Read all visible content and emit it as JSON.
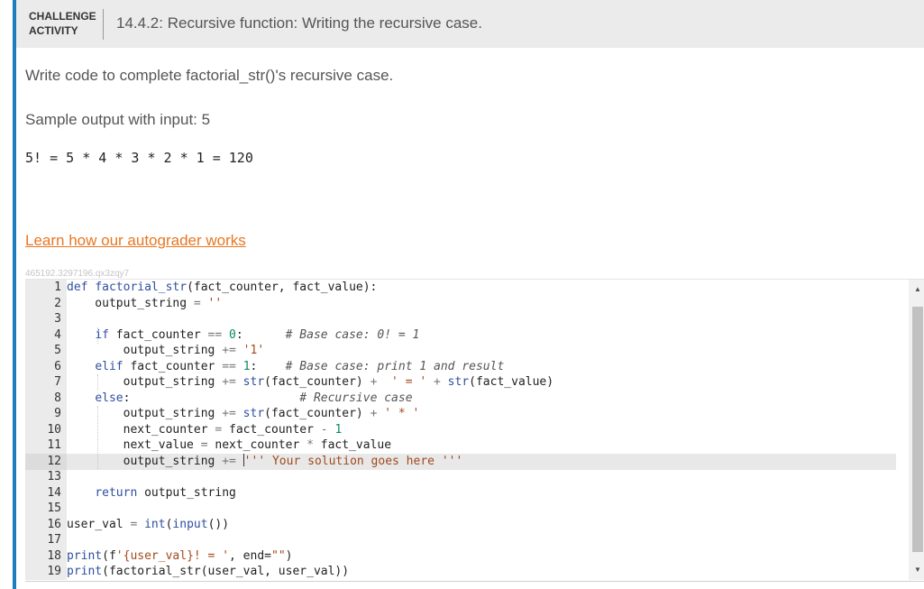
{
  "header": {
    "label_line1": "CHALLENGE",
    "label_line2": "ACTIVITY",
    "title": "14.4.2: Recursive function: Writing the recursive case."
  },
  "content": {
    "instructions": "Write code to complete factorial_str()'s recursive case.",
    "sample_label": "Sample output with input: 5",
    "sample_output": "5! = 5 * 4 * 3 * 2 * 1 = 120",
    "grader_link": "Learn how our autograder works",
    "activity_id": "465192.3297196.qx3zqy7"
  },
  "editor": {
    "active_line": 12,
    "line_numbers": [
      "1",
      "2",
      "3",
      "4",
      "5",
      "6",
      "7",
      "8",
      "9",
      "10",
      "11",
      "12",
      "13",
      "14",
      "15",
      "16",
      "17",
      "18",
      "19"
    ],
    "lines": [
      "def factorial_str(fact_counter, fact_value):",
      "    output_string = ''",
      "",
      "    if fact_counter == 0:      # Base case: 0! = 1",
      "        output_string += '1'",
      "    elif fact_counter == 1:    # Base case: print 1 and result",
      "        output_string += str(fact_counter) +  ' = ' + str(fact_value)",
      "    else:                        # Recursive case",
      "        output_string += str(fact_counter) + ' * '",
      "        next_counter = fact_counter - 1",
      "        next_value = next_counter * fact_value",
      "        output_string += ''' Your solution goes here '''",
      "",
      "    return output_string",
      "",
      "user_val = int(input())",
      "",
      "print(f'{user_val}! = ', end=\"\")",
      "print(factorial_str(user_val, user_val))"
    ]
  },
  "colors": {
    "accent_border": "#1d7bbf",
    "link": "#e87722",
    "header_bg": "#ebebeb"
  },
  "icons": {
    "scroll_up": "triangle-up",
    "scroll_down": "triangle-down"
  }
}
